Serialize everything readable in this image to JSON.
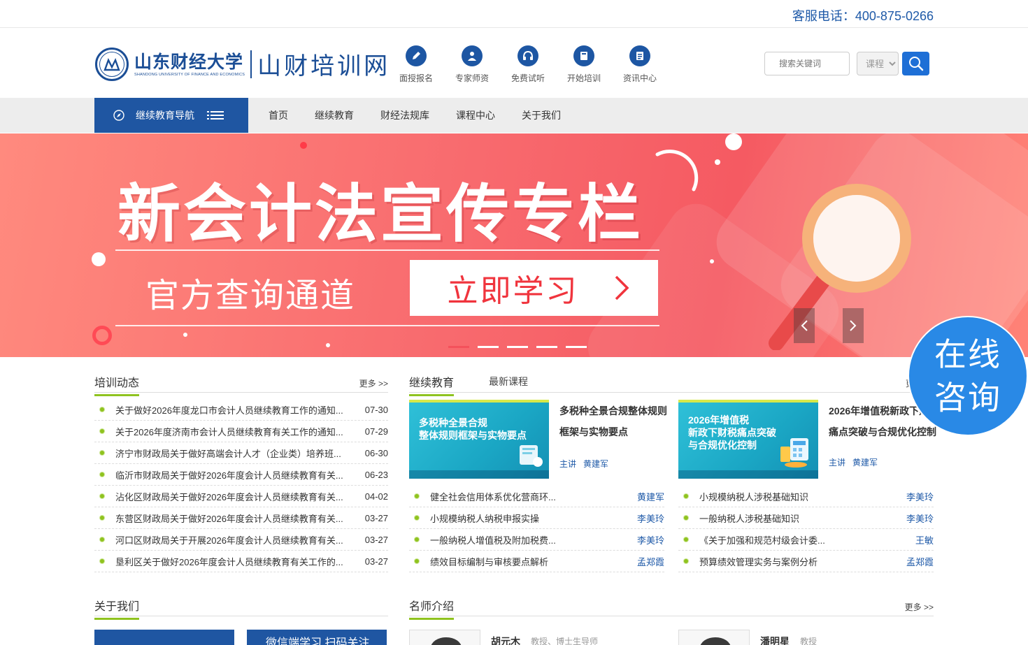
{
  "topbar": {
    "hotline": "客服电话：400-875-0266"
  },
  "logo": {
    "school_cn": "山东财经大学",
    "school_en": "SHANDONG UNIVERSITY OF FINANCE AND ECONOMICS",
    "site_name": "山财培训网"
  },
  "quick_links": [
    {
      "label": "面授报名",
      "icon": "pen-icon"
    },
    {
      "label": "专家师资",
      "icon": "teacher-icon"
    },
    {
      "label": "免费试听",
      "icon": "headphones-icon"
    },
    {
      "label": "开始培训",
      "icon": "book-icon"
    },
    {
      "label": "资讯中心",
      "icon": "document-icon"
    }
  ],
  "search": {
    "placeholder": "搜索关键词",
    "category_selected": "课程"
  },
  "nav": {
    "category_label": "继续教育导航",
    "links": [
      "首页",
      "继续教育",
      "财经法规库",
      "课程中心",
      "关于我们"
    ]
  },
  "banner": {
    "title": "新会计法宣传专栏",
    "subtitle": "官方查询通道",
    "button": "立即学习"
  },
  "consult": {
    "line1": "在线",
    "line2": "咨询"
  },
  "news": {
    "title": "培训动态",
    "more": "更多 >>",
    "items": [
      {
        "title": "关于做好2026年度龙口市会计人员继续教育工作的通知...",
        "date": "07-30"
      },
      {
        "title": "关于2026年度济南市会计人员继续教育有关工作的通知...",
        "date": "07-29"
      },
      {
        "title": "济宁市财政局关于做好高端会计人才（企业类）培养班...",
        "date": "06-30"
      },
      {
        "title": "临沂市财政局关于做好2026年度会计人员继续教育有关...",
        "date": "06-23"
      },
      {
        "title": "沾化区财政局关于做好2026年度会计人员继续教育有关...",
        "date": "04-02"
      },
      {
        "title": "东营区财政局关于做好2026年度会计人员继续教育有关...",
        "date": "03-27"
      },
      {
        "title": "河口区财政局关于开展2026年度会计人员继续教育有关...",
        "date": "03-27"
      },
      {
        "title": "垦利区关于做好2026年度会计人员继续教育有关工作的...",
        "date": "03-27"
      }
    ]
  },
  "courses": {
    "title": "继续教育",
    "tab2": "最新课程",
    "more_partial": "更",
    "lecturer_label": "主讲",
    "cards": [
      {
        "image_text_1": "多税种全景合规",
        "image_text_2": "整体规则框架与实物要点",
        "title": "多税种全景合规整体规则框架与实物要点",
        "lecturer": "黄建军"
      },
      {
        "image_text_1": "2026年增值税",
        "image_text_2": "新政下财税痛点突破",
        "image_text_3": "与合规优化控制",
        "title": "2026年增值税新政下财税痛点突破与合规优化控制",
        "lecturer": "黄建军"
      }
    ],
    "list_left": [
      {
        "title": "健全社会信用体系优化营商环...",
        "teacher": "黄建军"
      },
      {
        "title": "小规模纳税人纳税申报实操",
        "teacher": "李美玲"
      },
      {
        "title": "一般纳税人增值税及附加税费...",
        "teacher": "李美玲"
      },
      {
        "title": "绩效目标编制与审核要点解析",
        "teacher": "孟郑霞"
      }
    ],
    "list_right": [
      {
        "title": "小规模纳税人涉税基础知识",
        "teacher": "李美玲"
      },
      {
        "title": "一般纳税人涉税基础知识",
        "teacher": "李美玲"
      },
      {
        "title": "《关于加强和规范村级会计委...",
        "teacher": "王敏"
      },
      {
        "title": "预算绩效管理实务与案例分析",
        "teacher": "孟郑霞"
      }
    ]
  },
  "about": {
    "title": "关于我们",
    "wechat": "微信端学习 扫码关注"
  },
  "teachers": {
    "title": "名师介绍",
    "more": "更多 >>",
    "items": [
      {
        "name": "胡元木",
        "role": "教授、博士生导师"
      },
      {
        "name": "潘明星",
        "role": "教授"
      }
    ]
  },
  "colors": {
    "brand_blue": "#1f56a2",
    "accent_green": "#8fc31f",
    "banner_red": "#f55a62",
    "link_blue": "#1f5aa8"
  }
}
